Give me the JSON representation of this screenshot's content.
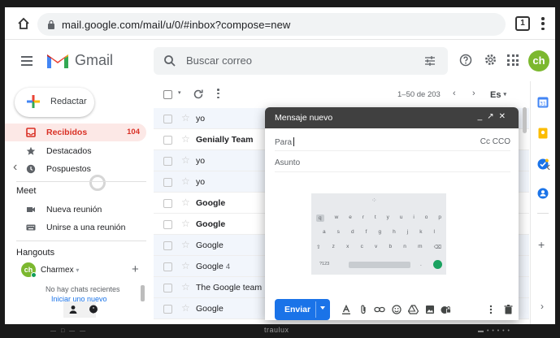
{
  "browser": {
    "url": "mail.google.com/mail/u/0/#inbox?compose=new",
    "tab_count": "1"
  },
  "header": {
    "app_name": "Gmail",
    "search_placeholder": "Buscar correo",
    "avatar_initials": "ch"
  },
  "sidebar": {
    "compose_label": "Redactar",
    "items": [
      {
        "label": "Recibidos",
        "count": "104",
        "icon": "inbox-icon"
      },
      {
        "label": "Destacados",
        "count": "",
        "icon": "star-icon"
      },
      {
        "label": "Pospuestos",
        "count": "",
        "icon": "clock-icon"
      }
    ],
    "meet_title": "Meet",
    "meet_items": [
      {
        "label": "Nueva reunión",
        "icon": "video-icon"
      },
      {
        "label": "Unirse a una reunión",
        "icon": "keyboard-icon"
      }
    ],
    "hangouts_title": "Hangouts",
    "hangouts_user": "Charmex",
    "hangouts_avatar": "ch",
    "no_chats": "No hay chats recientes",
    "start_chat": "Iniciar uno nuevo"
  },
  "list": {
    "pagination": "1–50 de 203",
    "lang": "Es",
    "rows": [
      {
        "from": "yo",
        "count": "",
        "bold": false,
        "read": true
      },
      {
        "from": "Genially Team",
        "count": "",
        "bold": true,
        "read": false
      },
      {
        "from": "yo",
        "count": "",
        "bold": false,
        "read": true
      },
      {
        "from": "yo",
        "count": "",
        "bold": false,
        "read": true
      },
      {
        "from": "Google",
        "count": "",
        "bold": true,
        "read": false
      },
      {
        "from": "Google",
        "count": "",
        "bold": true,
        "read": false
      },
      {
        "from": "Google",
        "count": "",
        "bold": false,
        "read": true
      },
      {
        "from": "Google",
        "count": "4",
        "bold": false,
        "read": true
      },
      {
        "from": "The Google team",
        "count": "",
        "bold": false,
        "read": true
      },
      {
        "from": "Google",
        "count": "",
        "bold": false,
        "read": true
      }
    ]
  },
  "compose": {
    "title": "Mensaje nuevo",
    "to_label": "Para",
    "cc_bcc": "Cc CCO",
    "subject_label": "Asunto",
    "send_label": "Enviar",
    "keyboard": {
      "row1": [
        "q",
        "w",
        "e",
        "r",
        "t",
        "y",
        "u",
        "i",
        "o",
        "p"
      ],
      "row2": [
        "a",
        "s",
        "d",
        "f",
        "g",
        "h",
        "j",
        "k",
        "l"
      ],
      "row3": [
        "⇧",
        "z",
        "x",
        "c",
        "v",
        "b",
        "n",
        "m",
        "⌫"
      ],
      "num_key": "?123",
      "dot_key": "."
    }
  },
  "bezel": {
    "brand": "traulux"
  },
  "colors": {
    "gmail_red": "#ea4335",
    "accent_blue": "#1a73e8",
    "active_bg": "#fce8e6",
    "avatar_green": "#7cb82f"
  }
}
